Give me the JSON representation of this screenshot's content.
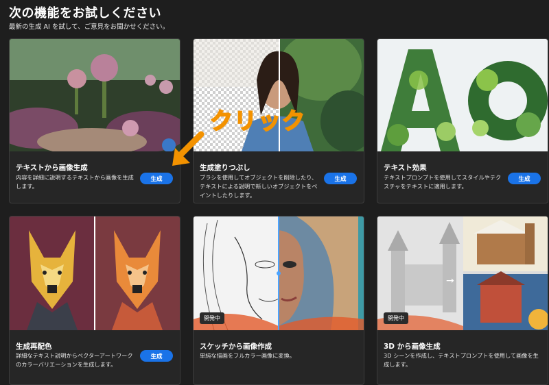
{
  "header": {
    "title": "次の機能をお試しください",
    "subtitle": "最新の生成 AI を試して、ご意見をお聞かせください。"
  },
  "annotation": {
    "label": "クリック",
    "color": "#f39200"
  },
  "cards": [
    {
      "title": "テキストから画像生成",
      "desc": "内容を詳細に説明するテキストから画像を生成します。",
      "button": "生成"
    },
    {
      "title": "生成塗りつぶし",
      "desc": "ブラシを使用してオブジェクトを削除したり、テキストによる説明で新しいオブジェクトをペイントしたりします。",
      "button": "生成"
    },
    {
      "title": "テキスト効果",
      "desc": "テキストプロンプトを使用してスタイルやテクスチャをテキストに適用します。",
      "button": "生成"
    },
    {
      "title": "生成再配色",
      "desc": "詳細なテキスト説明からベクターアートワークのカラーバリエーションを生成します。",
      "button": "生成"
    },
    {
      "title": "スケッチから画像作成",
      "desc": "単純な描画をフルカラー画像に変換。",
      "badge": "開発中"
    },
    {
      "title": "3D から画像生成",
      "desc": "3D シーンを作成し、テキストプロンプトを使用して画像を生成します。",
      "badge": "開発中"
    }
  ],
  "colors": {
    "background": "#1e1e1e",
    "card": "#262626",
    "button": "#1a73e8",
    "accent": "#f39200"
  }
}
